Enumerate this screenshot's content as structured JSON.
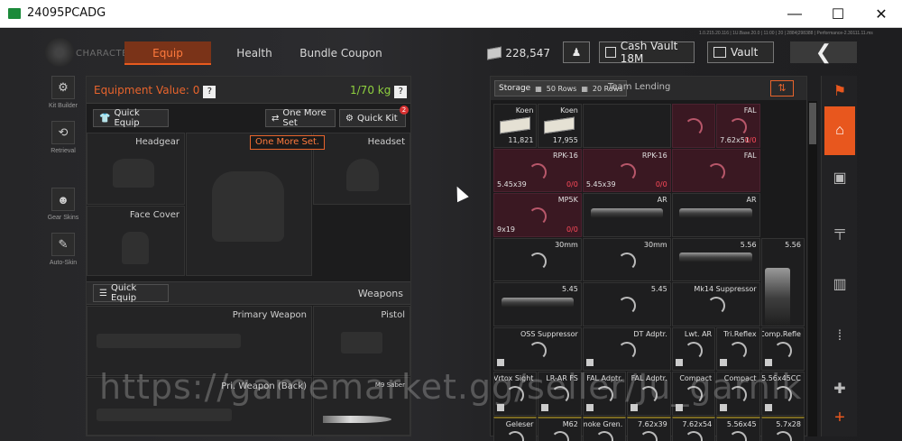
{
  "window": {
    "title": "24095PCADG",
    "minimize": "—",
    "maximize": "☐",
    "close": "✕"
  },
  "header": {
    "character_label": "CHARACTER",
    "tabs": [
      {
        "label": "Equip",
        "active": true
      },
      {
        "label": "Health",
        "active": false
      },
      {
        "label": "Bundle Coupon",
        "active": false
      }
    ],
    "money": "228,547",
    "cash_vault": "Cash Vault 18M",
    "vault": "Vault",
    "back_icon": "chevron-left-icon",
    "version": "1.0.215.20.116 | 1U.Base.20.0 | 11:00 | 20 | 2884|298388 | Performance-2.30111.11.ms"
  },
  "left_sidebar": [
    {
      "label": "Kit Builder",
      "icon": "kit-builder-icon"
    },
    {
      "label": "Retrieval",
      "icon": "retrieval-icon"
    },
    {
      "label": "Gear Skins",
      "icon": "gear-skins-icon"
    },
    {
      "label": "Auto-Skin",
      "icon": "auto-skin-icon"
    }
  ],
  "equip": {
    "value_label": "Equipment Value: 0",
    "weight": "1/70 kg",
    "help": "?",
    "quick_equip": "Quick Equip",
    "one_more_set": "One More Set",
    "quick_kit": "Quick Kit",
    "quick_kit_badge": "2",
    "tooltip": "One More Set.",
    "slots": {
      "headgear": "Headgear",
      "headset": "Headset",
      "face_cover": "Face Cover"
    },
    "weapons_section": {
      "title": "Weapons",
      "quick_equip": "Quick Equip",
      "primary": "Primary Weapon",
      "pistol": "Pistol",
      "back": "Pri. Weapon (Back)",
      "melee": "M9 Saber"
    }
  },
  "storage": {
    "tab_label": "Storage",
    "rows_a": "50 Rows",
    "rows_b": "20 Rows",
    "team_lending": "Team Lending",
    "cells": [
      {
        "name": "Koen",
        "count": "11,821",
        "type": "cash"
      },
      {
        "name": "Koen",
        "count": "17,955",
        "type": "cash"
      },
      {
        "name": "",
        "type": "empty"
      },
      {
        "name": "",
        "type": "red"
      },
      {
        "name": "FAL",
        "caliber": "7.62x51",
        "ammo": "0/0",
        "type": "red"
      },
      {
        "name": "RPK-16",
        "caliber": "5.45x39",
        "ammo": "0/0",
        "type": "red"
      },
      {
        "name": "RPK-16",
        "caliber": "5.45x39",
        "ammo": "0/0",
        "type": "red"
      },
      {
        "name": "FAL",
        "type": "red"
      },
      {
        "name": "MP5K",
        "caliber": "9x19",
        "ammo": "0/0",
        "type": "red-ring"
      },
      {
        "name": "AR",
        "type": "item"
      },
      {
        "name": "AR",
        "type": "item"
      },
      {
        "name": "30mm",
        "type": "ring"
      },
      {
        "name": "30mm",
        "type": "ring"
      },
      {
        "name": "5.56",
        "type": "item"
      },
      {
        "name": "5.56",
        "type": "item"
      },
      {
        "name": "5.45",
        "type": "item"
      },
      {
        "name": "5.45",
        "type": "ring"
      },
      {
        "name": "Mk14 Suppressor",
        "type": "ring"
      },
      {
        "name": "OSS Suppressor",
        "type": "ring"
      },
      {
        "name": "DT Adptr.",
        "type": "ring"
      },
      {
        "name": "Lwt. AR",
        "type": "ring"
      },
      {
        "name": "Tri.Reflex",
        "type": "ring"
      },
      {
        "name": "Comp.Refle",
        "type": "ring"
      },
      {
        "name": "Vrtox Sight",
        "type": "ring"
      },
      {
        "name": "LR-AR FS",
        "type": "ring"
      },
      {
        "name": "FAL Adptr.",
        "type": "ring"
      },
      {
        "name": "FAL Adptr.",
        "type": "ring"
      },
      {
        "name": "Compact",
        "type": "ring"
      },
      {
        "name": "Compact",
        "type": "ring"
      },
      {
        "name": "5.56x45CC",
        "type": "ring"
      },
      {
        "name": "Geleser",
        "type": "ring"
      },
      {
        "name": "M62",
        "type": "ring"
      },
      {
        "name": "Smoke Gren.",
        "type": "ring"
      },
      {
        "name": "7.62x39",
        "type": "ring"
      },
      {
        "name": "7.62x54",
        "type": "ring"
      },
      {
        "name": "5.56x45",
        "type": "ring"
      },
      {
        "name": "5.7x28",
        "type": "ring"
      }
    ]
  },
  "right_sidebar": [
    "home-icon",
    "vest-icon",
    "rifle-icon",
    "magazine-icon",
    "ammo-icon",
    "medkit-icon",
    "add-icon"
  ],
  "watermark": "https://gamemarket.gg/seller/Ju_garnik"
}
